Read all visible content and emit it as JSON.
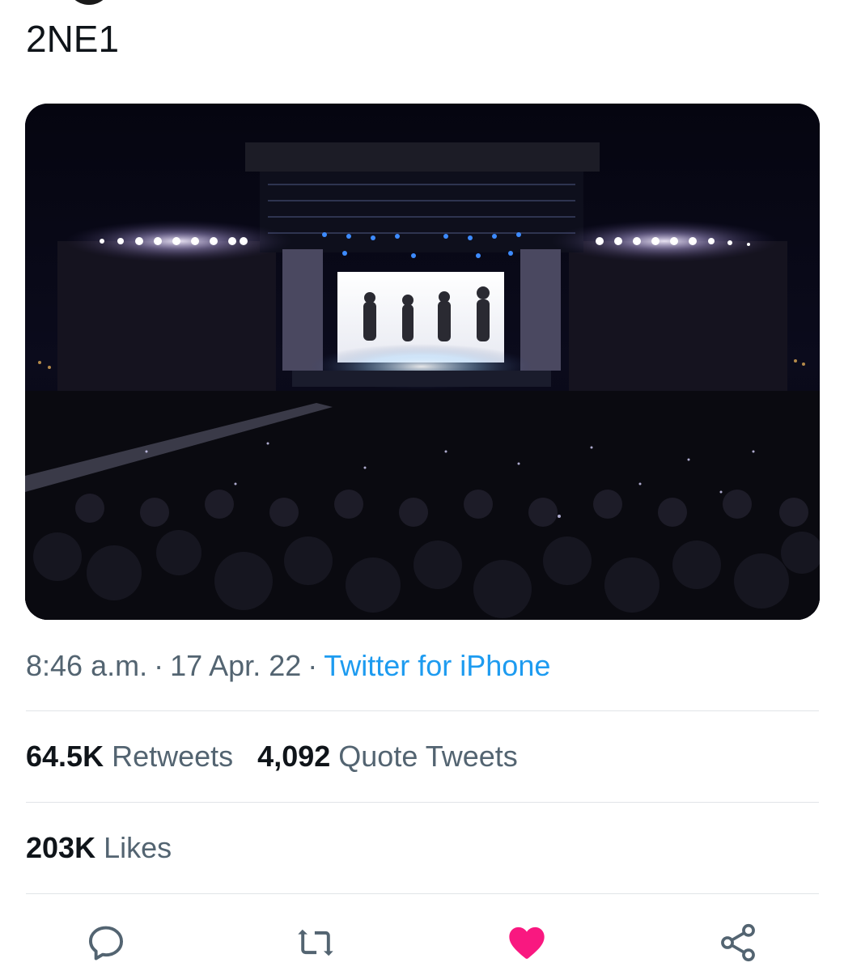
{
  "tweet": {
    "text": "2NE1",
    "image_alt": "Concert stage at night with four performers silhouetted on a bright screen in front of a large crowd"
  },
  "meta": {
    "time": "8:46 a.m.",
    "separator": "·",
    "date": "17 Apr. 22",
    "source": "Twitter for iPhone"
  },
  "stats": {
    "retweets_count": "64.5K",
    "retweets_label": "Retweets",
    "quotes_count": "4,092",
    "quotes_label": "Quote Tweets",
    "likes_count": "203K",
    "likes_label": "Likes"
  },
  "actions": [
    {
      "name": "reply",
      "icon": "reply-icon",
      "liked": false
    },
    {
      "name": "retweet",
      "icon": "retweet-icon",
      "liked": false
    },
    {
      "name": "like",
      "icon": "heart-icon",
      "liked": true
    },
    {
      "name": "share",
      "icon": "share-icon",
      "liked": false
    }
  ],
  "colors": {
    "text": "#0f1419",
    "secondary": "#536471",
    "link": "#1d9bf0",
    "like": "#f91880",
    "divider": "#e1e4e8"
  }
}
